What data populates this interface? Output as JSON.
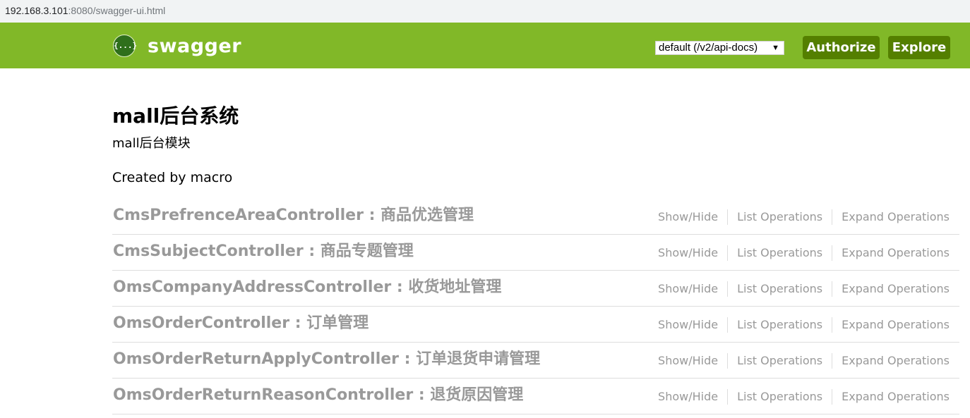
{
  "browser": {
    "url_host": "192.168.3.101",
    "url_rest": ":8080/swagger-ui.html"
  },
  "header": {
    "logo_glyph": "{...}",
    "logo_text": "swagger",
    "spec_select_value": "default (/v2/api-docs)",
    "authorize_label": "Authorize",
    "explore_label": "Explore",
    "colors": {
      "header_bg": "#81b828",
      "button_bg": "#547f00"
    }
  },
  "info": {
    "title": "mall后台系统",
    "description": "mall后台模块",
    "created_by": "Created by macro"
  },
  "resources": [
    {
      "name": "CmsPrefrenceAreaController : 商品优选管理",
      "show_hide": "Show/Hide",
      "list_ops": "List Operations",
      "expand_ops": "Expand Operations"
    },
    {
      "name": "CmsSubjectController : 商品专题管理",
      "show_hide": "Show/Hide",
      "list_ops": "List Operations",
      "expand_ops": "Expand Operations"
    },
    {
      "name": "OmsCompanyAddressController : 收货地址管理",
      "show_hide": "Show/Hide",
      "list_ops": "List Operations",
      "expand_ops": "Expand Operations"
    },
    {
      "name": "OmsOrderController : 订单管理",
      "show_hide": "Show/Hide",
      "list_ops": "List Operations",
      "expand_ops": "Expand Operations"
    },
    {
      "name": "OmsOrderReturnApplyController : 订单退货申请管理",
      "show_hide": "Show/Hide",
      "list_ops": "List Operations",
      "expand_ops": "Expand Operations"
    },
    {
      "name": "OmsOrderReturnReasonController : 退货原因管理",
      "show_hide": "Show/Hide",
      "list_ops": "List Operations",
      "expand_ops": "Expand Operations"
    }
  ]
}
